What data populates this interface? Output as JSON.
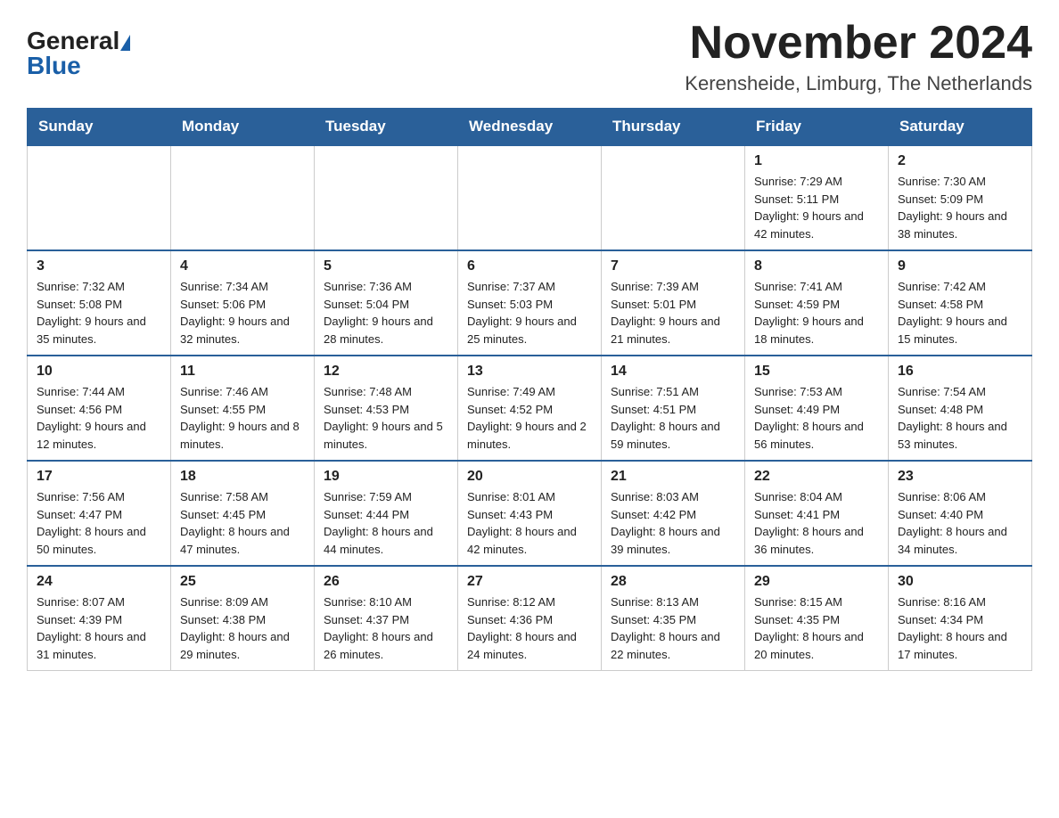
{
  "header": {
    "logo_general": "General",
    "logo_blue": "Blue",
    "month_title": "November 2024",
    "location": "Kerensheide, Limburg, The Netherlands"
  },
  "weekdays": [
    "Sunday",
    "Monday",
    "Tuesday",
    "Wednesday",
    "Thursday",
    "Friday",
    "Saturday"
  ],
  "weeks": [
    [
      {
        "day": "",
        "info": ""
      },
      {
        "day": "",
        "info": ""
      },
      {
        "day": "",
        "info": ""
      },
      {
        "day": "",
        "info": ""
      },
      {
        "day": "",
        "info": ""
      },
      {
        "day": "1",
        "info": "Sunrise: 7:29 AM\nSunset: 5:11 PM\nDaylight: 9 hours and 42 minutes."
      },
      {
        "day": "2",
        "info": "Sunrise: 7:30 AM\nSunset: 5:09 PM\nDaylight: 9 hours and 38 minutes."
      }
    ],
    [
      {
        "day": "3",
        "info": "Sunrise: 7:32 AM\nSunset: 5:08 PM\nDaylight: 9 hours and 35 minutes."
      },
      {
        "day": "4",
        "info": "Sunrise: 7:34 AM\nSunset: 5:06 PM\nDaylight: 9 hours and 32 minutes."
      },
      {
        "day": "5",
        "info": "Sunrise: 7:36 AM\nSunset: 5:04 PM\nDaylight: 9 hours and 28 minutes."
      },
      {
        "day": "6",
        "info": "Sunrise: 7:37 AM\nSunset: 5:03 PM\nDaylight: 9 hours and 25 minutes."
      },
      {
        "day": "7",
        "info": "Sunrise: 7:39 AM\nSunset: 5:01 PM\nDaylight: 9 hours and 21 minutes."
      },
      {
        "day": "8",
        "info": "Sunrise: 7:41 AM\nSunset: 4:59 PM\nDaylight: 9 hours and 18 minutes."
      },
      {
        "day": "9",
        "info": "Sunrise: 7:42 AM\nSunset: 4:58 PM\nDaylight: 9 hours and 15 minutes."
      }
    ],
    [
      {
        "day": "10",
        "info": "Sunrise: 7:44 AM\nSunset: 4:56 PM\nDaylight: 9 hours and 12 minutes."
      },
      {
        "day": "11",
        "info": "Sunrise: 7:46 AM\nSunset: 4:55 PM\nDaylight: 9 hours and 8 minutes."
      },
      {
        "day": "12",
        "info": "Sunrise: 7:48 AM\nSunset: 4:53 PM\nDaylight: 9 hours and 5 minutes."
      },
      {
        "day": "13",
        "info": "Sunrise: 7:49 AM\nSunset: 4:52 PM\nDaylight: 9 hours and 2 minutes."
      },
      {
        "day": "14",
        "info": "Sunrise: 7:51 AM\nSunset: 4:51 PM\nDaylight: 8 hours and 59 minutes."
      },
      {
        "day": "15",
        "info": "Sunrise: 7:53 AM\nSunset: 4:49 PM\nDaylight: 8 hours and 56 minutes."
      },
      {
        "day": "16",
        "info": "Sunrise: 7:54 AM\nSunset: 4:48 PM\nDaylight: 8 hours and 53 minutes."
      }
    ],
    [
      {
        "day": "17",
        "info": "Sunrise: 7:56 AM\nSunset: 4:47 PM\nDaylight: 8 hours and 50 minutes."
      },
      {
        "day": "18",
        "info": "Sunrise: 7:58 AM\nSunset: 4:45 PM\nDaylight: 8 hours and 47 minutes."
      },
      {
        "day": "19",
        "info": "Sunrise: 7:59 AM\nSunset: 4:44 PM\nDaylight: 8 hours and 44 minutes."
      },
      {
        "day": "20",
        "info": "Sunrise: 8:01 AM\nSunset: 4:43 PM\nDaylight: 8 hours and 42 minutes."
      },
      {
        "day": "21",
        "info": "Sunrise: 8:03 AM\nSunset: 4:42 PM\nDaylight: 8 hours and 39 minutes."
      },
      {
        "day": "22",
        "info": "Sunrise: 8:04 AM\nSunset: 4:41 PM\nDaylight: 8 hours and 36 minutes."
      },
      {
        "day": "23",
        "info": "Sunrise: 8:06 AM\nSunset: 4:40 PM\nDaylight: 8 hours and 34 minutes."
      }
    ],
    [
      {
        "day": "24",
        "info": "Sunrise: 8:07 AM\nSunset: 4:39 PM\nDaylight: 8 hours and 31 minutes."
      },
      {
        "day": "25",
        "info": "Sunrise: 8:09 AM\nSunset: 4:38 PM\nDaylight: 8 hours and 29 minutes."
      },
      {
        "day": "26",
        "info": "Sunrise: 8:10 AM\nSunset: 4:37 PM\nDaylight: 8 hours and 26 minutes."
      },
      {
        "day": "27",
        "info": "Sunrise: 8:12 AM\nSunset: 4:36 PM\nDaylight: 8 hours and 24 minutes."
      },
      {
        "day": "28",
        "info": "Sunrise: 8:13 AM\nSunset: 4:35 PM\nDaylight: 8 hours and 22 minutes."
      },
      {
        "day": "29",
        "info": "Sunrise: 8:15 AM\nSunset: 4:35 PM\nDaylight: 8 hours and 20 minutes."
      },
      {
        "day": "30",
        "info": "Sunrise: 8:16 AM\nSunset: 4:34 PM\nDaylight: 8 hours and 17 minutes."
      }
    ]
  ]
}
